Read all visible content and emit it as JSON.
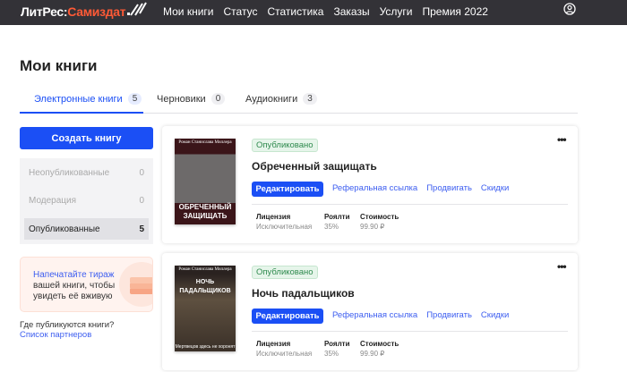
{
  "header": {
    "logo_main": "ЛитРес:",
    "logo_accent": "Самиздат",
    "nav": [
      "Мои книги",
      "Статус",
      "Статистика",
      "Заказы",
      "Услуги",
      "Премия 2022"
    ]
  },
  "page_title": "Мои книги",
  "tabs": [
    {
      "label": "Электронные книги",
      "count": "5"
    },
    {
      "label": "Черновики",
      "count": "0"
    },
    {
      "label": "Аудиокниги",
      "count": "3"
    }
  ],
  "sidebar": {
    "create_label": "Создать книгу",
    "statuses": [
      {
        "label": "Неопубликованные",
        "count": "0"
      },
      {
        "label": "Модерация",
        "count": "0"
      },
      {
        "label": "Опубликованные",
        "count": "5"
      }
    ],
    "promo": {
      "link": "Напечатайте тираж",
      "text": "вашей книги, чтобы увидеть её вживую"
    },
    "where_question": "Где публикуются книги?",
    "partners_link": "Список партнеров"
  },
  "books": [
    {
      "status": "Опубликовано",
      "title": "Обреченный защищать",
      "cover_author": "Роман Станислава Миллера",
      "cover_title": "ОБРЕЧЕННЫЙ ЗАЩИЩАТЬ",
      "cover_sub": "",
      "edit": "Редактировать",
      "links": [
        "Реферальная ссылка",
        "Продвигать",
        "Скидки"
      ],
      "license_label": "Лицензия",
      "license": "Исключительная",
      "royalty_label": "Роялти",
      "royalty": "35%",
      "price_label": "Стоимость",
      "price": "99.90 ₽"
    },
    {
      "status": "Опубликовано",
      "title": "Ночь падальщиков",
      "cover_author": "Роман Станислава Миллера",
      "cover_title": "НОЧЬ ПАДАЛЬЩИКОВ",
      "cover_sub": "Мертвецов здесь не хоронят",
      "edit": "Редактировать",
      "links": [
        "Реферальная ссылка",
        "Продвигать",
        "Скидки"
      ],
      "license_label": "Лицензия",
      "license": "Исключительная",
      "royalty_label": "Роялти",
      "royalty": "35%",
      "price_label": "Стоимость",
      "price": "99.90 ₽"
    }
  ],
  "more_icon": "•••"
}
